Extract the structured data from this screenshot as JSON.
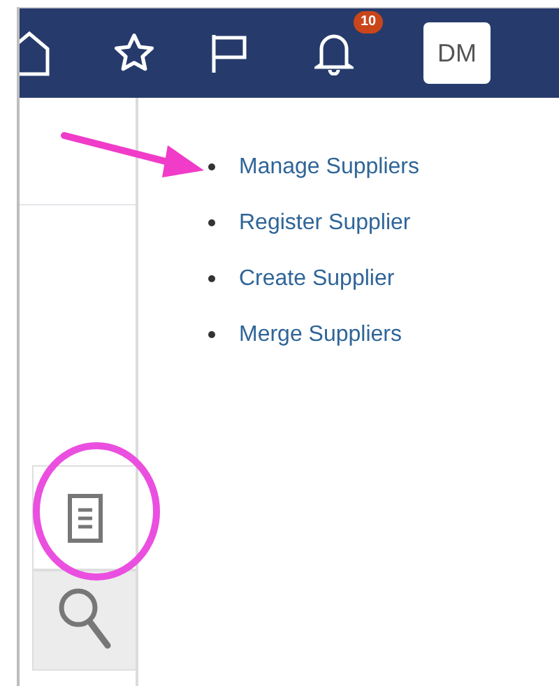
{
  "header": {
    "notifications": {
      "badge": "10"
    },
    "avatar": {
      "initials": "DM"
    }
  },
  "links": [
    {
      "label": "Manage Suppliers"
    },
    {
      "label": "Register Supplier"
    },
    {
      "label": "Create Supplier"
    },
    {
      "label": "Merge Suppliers"
    }
  ],
  "side_panel_tabs": [
    {
      "kind": "document",
      "selected": true
    },
    {
      "kind": "search",
      "selected": false
    }
  ],
  "annotations": {
    "arrow": true,
    "circle": true
  }
}
